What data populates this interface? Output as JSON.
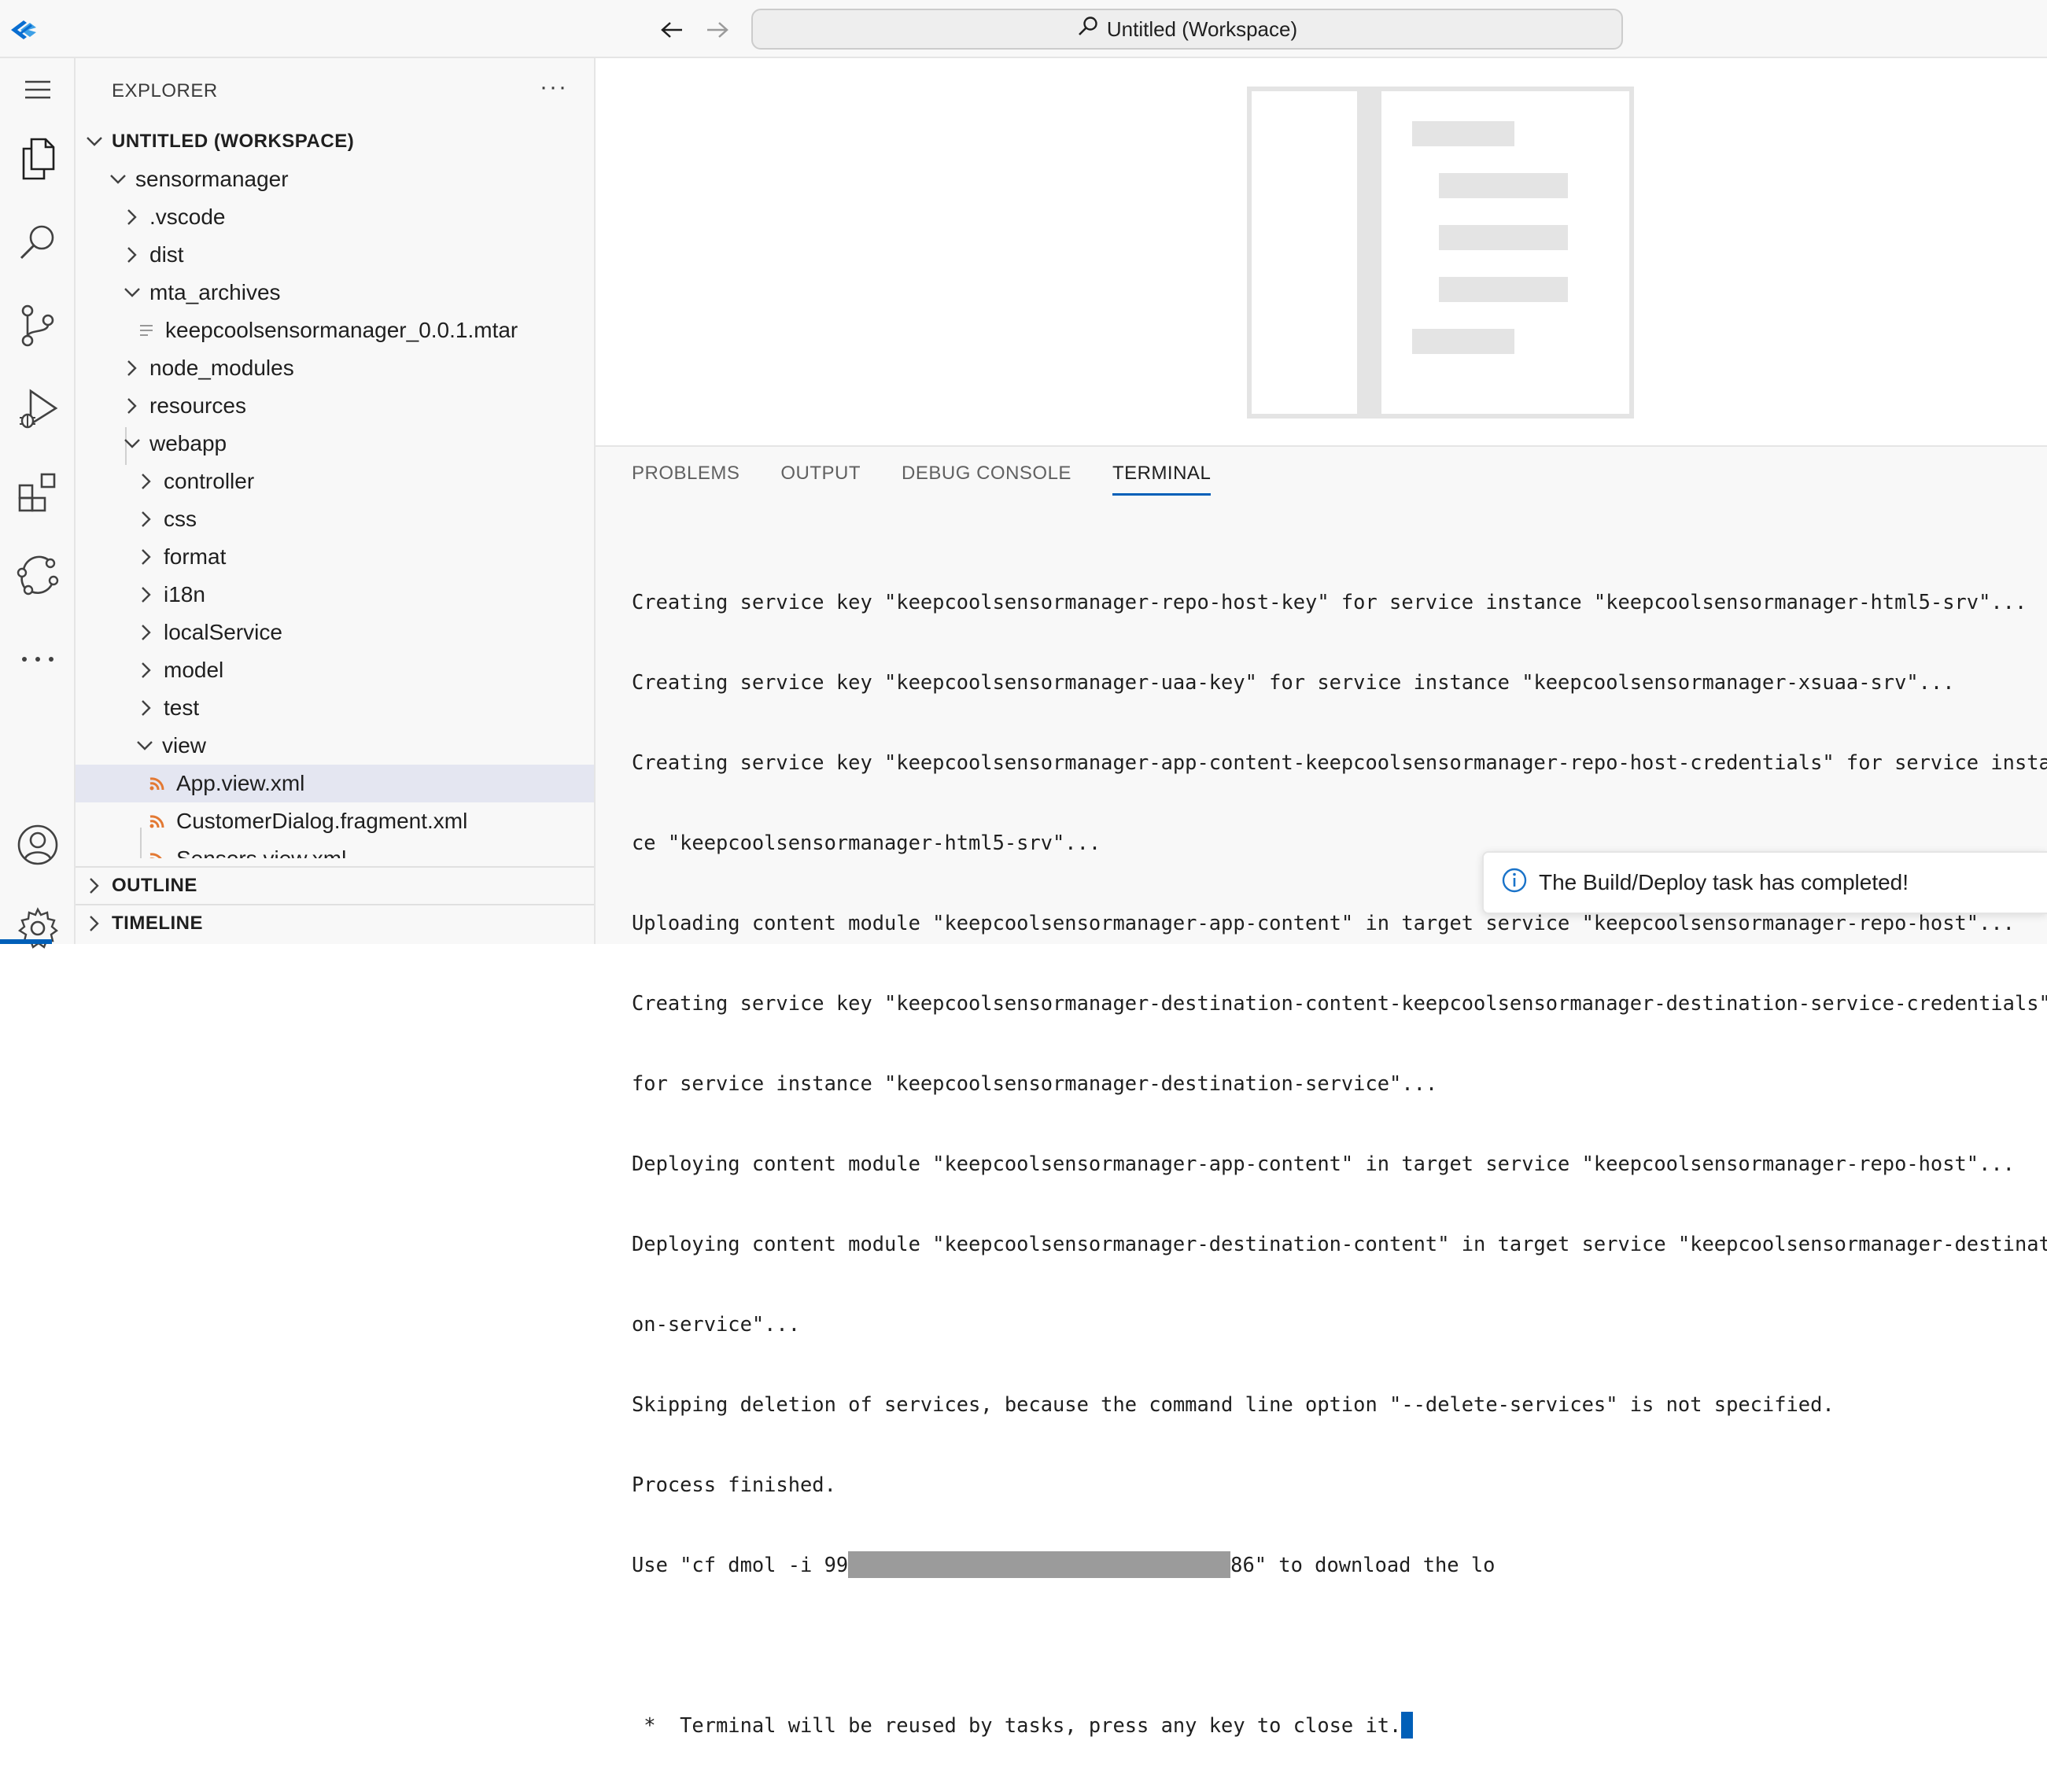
{
  "titlebar": {
    "search_text": "Untitled (Workspace)"
  },
  "activity_bar": {
    "items": [
      "menu",
      "explorer",
      "search",
      "source-control",
      "run-and-debug",
      "extensions",
      "remote-explorer",
      "more"
    ],
    "bottom_items": [
      "accounts",
      "manage"
    ]
  },
  "sidebar": {
    "title": "EXPLORER",
    "more_label": "···",
    "workspace_label": "UNTITLED (WORKSPACE)",
    "tree": {
      "sensormanager": "sensormanager",
      "vscode": ".vscode",
      "dist": "dist",
      "mta_archives": "mta_archives",
      "mtar": "keepcoolsensormanager_0.0.1.mtar",
      "node_modules": "node_modules",
      "resources": "resources",
      "webapp": "webapp",
      "controller": "controller",
      "css": "css",
      "format": "format",
      "i18n": "i18n",
      "localService": "localService",
      "model": "model",
      "test": "test",
      "view": "view",
      "app_view": "App.view.xml",
      "customer_dialog": "CustomerDialog.fragment.xml",
      "sensors_view": "Sensors.view.xml"
    },
    "outline_label": "OUTLINE",
    "timeline_label": "TIMELINE"
  },
  "panel": {
    "tabs": [
      "PROBLEMS",
      "OUTPUT",
      "DEBUG CONSOLE",
      "TERMINAL"
    ],
    "active_tab": "TERMINAL",
    "terminal_lines": [
      "Creating service key \"keepcoolsensormanager-repo-host-key\" for service instance \"keepcoolsensormanager-html5-srv\"...",
      "Creating service key \"keepcoolsensormanager-uaa-key\" for service instance \"keepcoolsensormanager-xsuaa-srv\"...",
      "Creating service key \"keepcoolsensormanager-app-content-keepcoolsensormanager-repo-host-credentials\" for service instan",
      "ce \"keepcoolsensormanager-html5-srv\"...",
      "Uploading content module \"keepcoolsensormanager-app-content\" in target service \"keepcoolsensormanager-repo-host\"...",
      "Creating service key \"keepcoolsensormanager-destination-content-keepcoolsensormanager-destination-service-credentials\"",
      "for service instance \"keepcoolsensormanager-destination-service\"...",
      "Deploying content module \"keepcoolsensormanager-app-content\" in target service \"keepcoolsensormanager-repo-host\"...",
      "Deploying content module \"keepcoolsensormanager-destination-content\" in target service \"keepcoolsensormanager-destinati",
      "on-service\"...",
      "Skipping deletion of services, because the command line option \"--delete-services\" is not specified.",
      "Process finished."
    ],
    "use_line_start": "Use \"cf dmol -i 99",
    "use_line_end": "86\" to download the lo",
    "reuse_line": " *  Terminal will be reused by tasks, press any key to close it."
  },
  "notification": {
    "message": "The Build/Deploy task has completed!"
  },
  "colors": {
    "accent": "#005fb8",
    "selection": "#e4e6f1",
    "xml_icon": "#e37933"
  }
}
